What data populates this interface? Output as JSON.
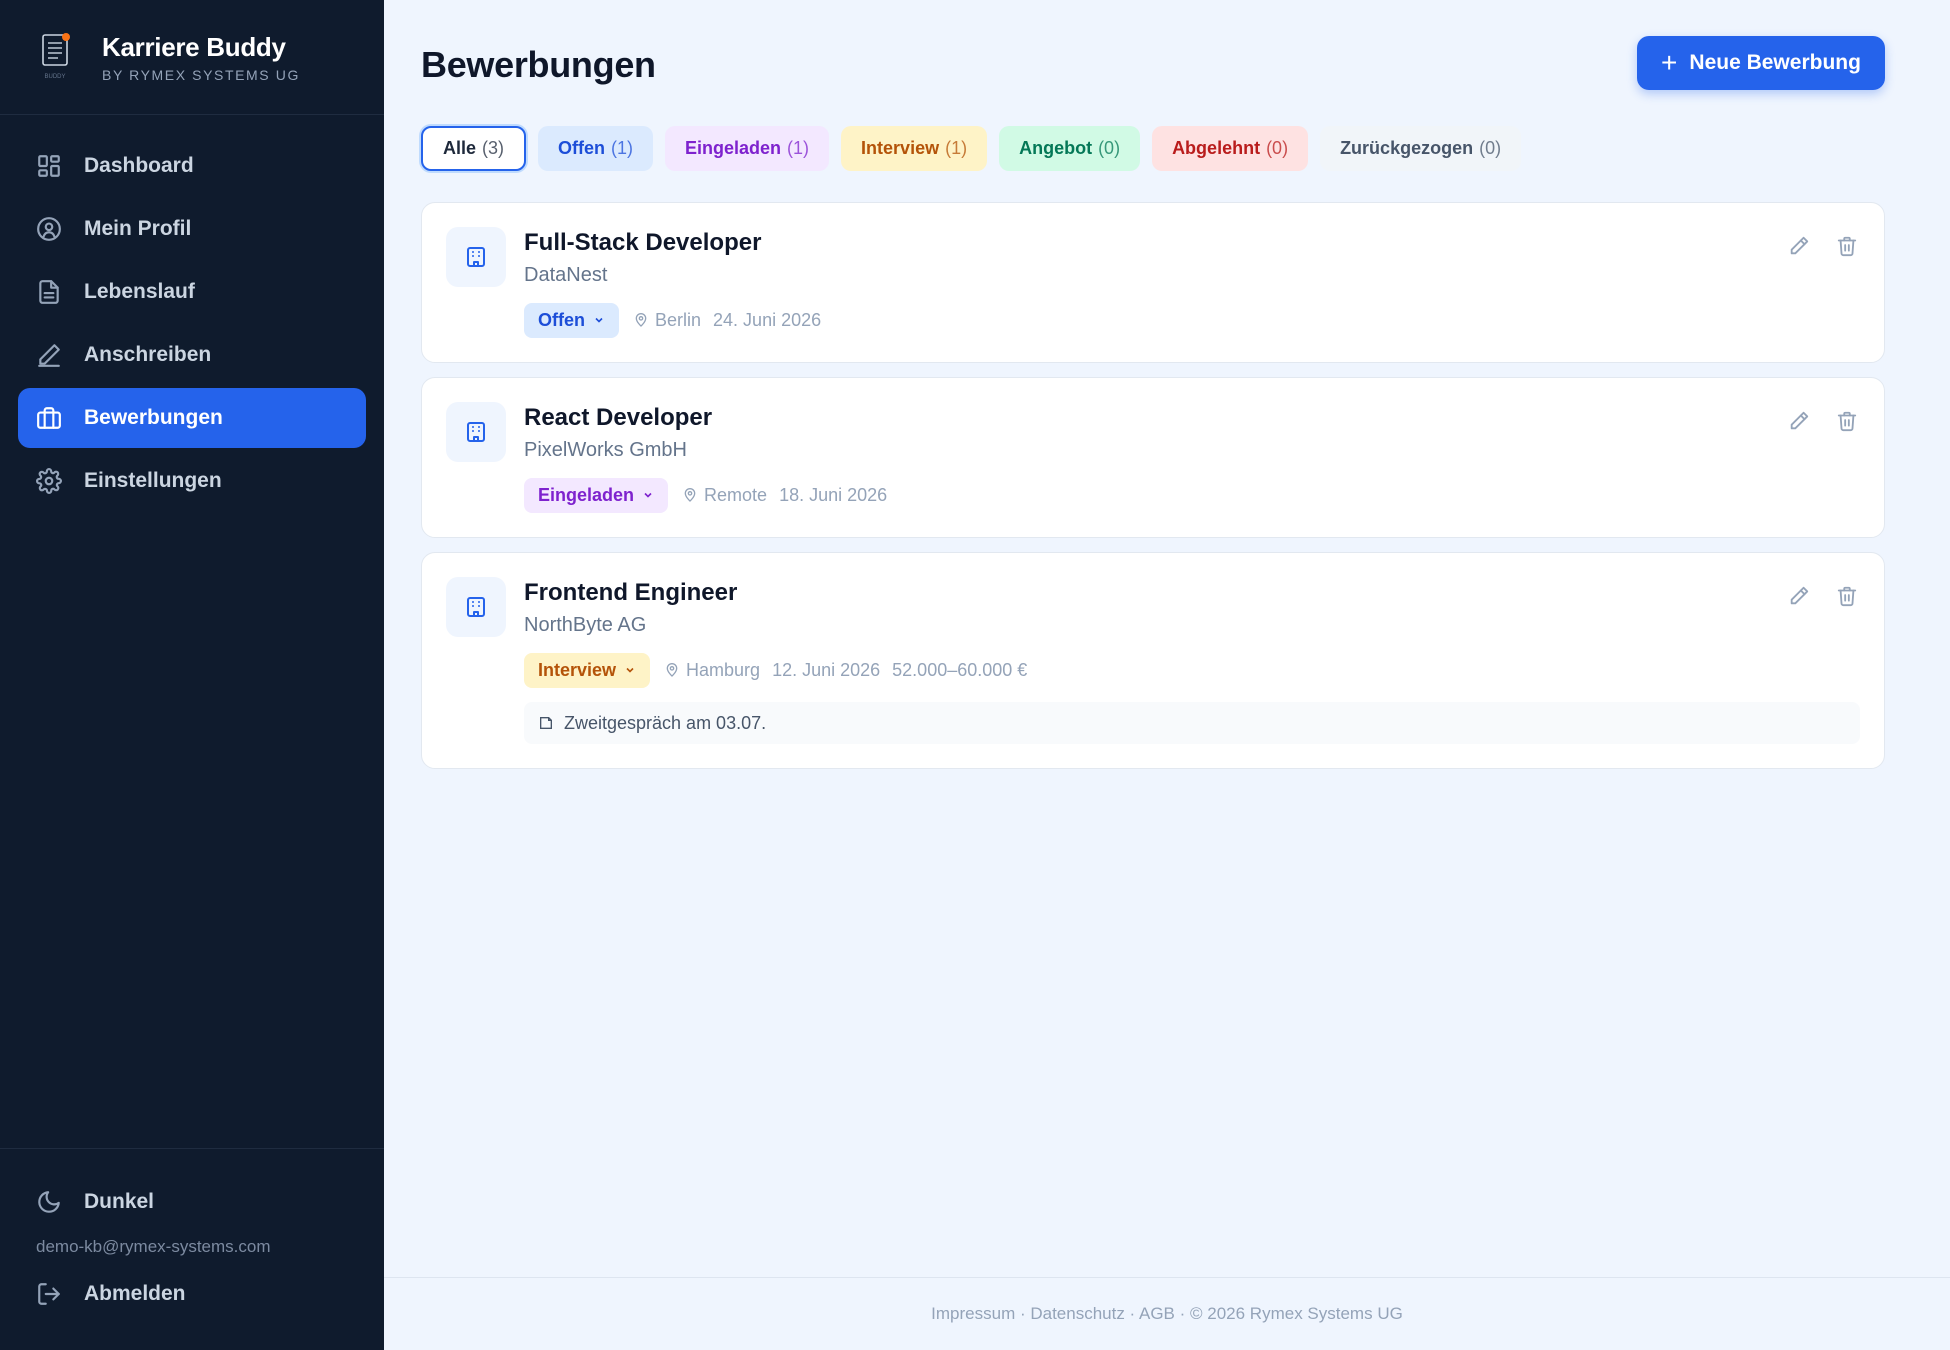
{
  "brand": {
    "name": "Karriere Buddy",
    "subtitle": "BY RYMEX SYSTEMS UG",
    "logo_caption": "BUDDY"
  },
  "sidebar": {
    "items": [
      {
        "label": "Dashboard",
        "icon": "dashboard-icon"
      },
      {
        "label": "Mein Profil",
        "icon": "user-circle-icon"
      },
      {
        "label": "Lebenslauf",
        "icon": "document-icon"
      },
      {
        "label": "Anschreiben",
        "icon": "pen-icon"
      },
      {
        "label": "Bewerbungen",
        "icon": "briefcase-icon",
        "active": true
      },
      {
        "label": "Einstellungen",
        "icon": "gear-icon"
      }
    ],
    "theme_toggle": "Dunkel",
    "email": "demo-kb@rymex-systems.com",
    "logout": "Abmelden"
  },
  "header": {
    "title": "Bewerbungen",
    "new_button": "Neue Bewerbung"
  },
  "filters": [
    {
      "label": "Alle",
      "count": "(3)"
    },
    {
      "label": "Offen",
      "count": "(1)"
    },
    {
      "label": "Eingeladen",
      "count": "(1)"
    },
    {
      "label": "Interview",
      "count": "(1)"
    },
    {
      "label": "Angebot",
      "count": "(0)"
    },
    {
      "label": "Abgelehnt",
      "count": "(0)"
    },
    {
      "label": "Zurückgezogen",
      "count": "(0)"
    }
  ],
  "applications": [
    {
      "title": "Full-Stack Developer",
      "company": "DataNest",
      "status": "Offen",
      "location": "Berlin",
      "date": "24. Juni 2026"
    },
    {
      "title": "React Developer",
      "company": "PixelWorks GmbH",
      "status": "Eingeladen",
      "location": "Remote",
      "date": "18. Juni 2026"
    },
    {
      "title": "Frontend Engineer",
      "company": "NorthByte AG",
      "status": "Interview",
      "location": "Hamburg",
      "date": "12. Juni 2026",
      "salary": "52.000–60.000 €",
      "note": "Zweitgespräch am 03.07."
    }
  ],
  "footer": {
    "text": "Impressum · Datenschutz · AGB · © 2026 Rymex Systems UG"
  },
  "colors": {
    "accent": "#2563eb",
    "sidebar_bg": "#0f1b2d",
    "page_bg": "#eff5fe"
  }
}
